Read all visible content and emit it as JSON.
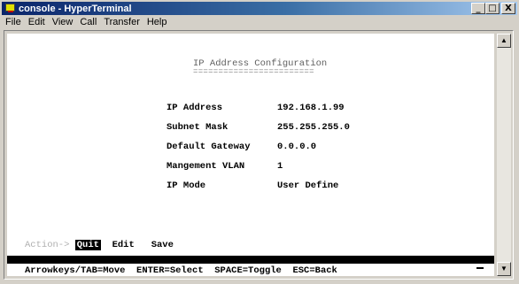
{
  "window": {
    "title": "console - HyperTerminal",
    "minimize": "_",
    "maximize": "□",
    "close": "X"
  },
  "menu": [
    "File",
    "Edit",
    "View",
    "Call",
    "Transfer",
    "Help"
  ],
  "screen": {
    "heading": "IP Address Configuration",
    "heading_underline": "========================",
    "fields": [
      {
        "label": "IP Address",
        "value": "192.168.1.99"
      },
      {
        "label": "Subnet Mask",
        "value": "255.255.255.0"
      },
      {
        "label": "Default Gateway",
        "value": "0.0.0.0"
      },
      {
        "label": "Mangement VLAN",
        "value": "1"
      },
      {
        "label": "IP Mode",
        "value": "User Define"
      }
    ],
    "action_label": "Action->",
    "actions": [
      "Quit",
      "Edit",
      "Save"
    ],
    "help": "Arrowkeys/TAB=Move  ENTER=Select  SPACE=Toggle  ESC=Back"
  },
  "scrollbar": {
    "up": "▲",
    "down": "▼"
  },
  "colors": {
    "title_start": "#0a246a",
    "title_end": "#a6caf0",
    "chrome": "#d4d0c8",
    "terminal_bg": "#ffffff"
  }
}
